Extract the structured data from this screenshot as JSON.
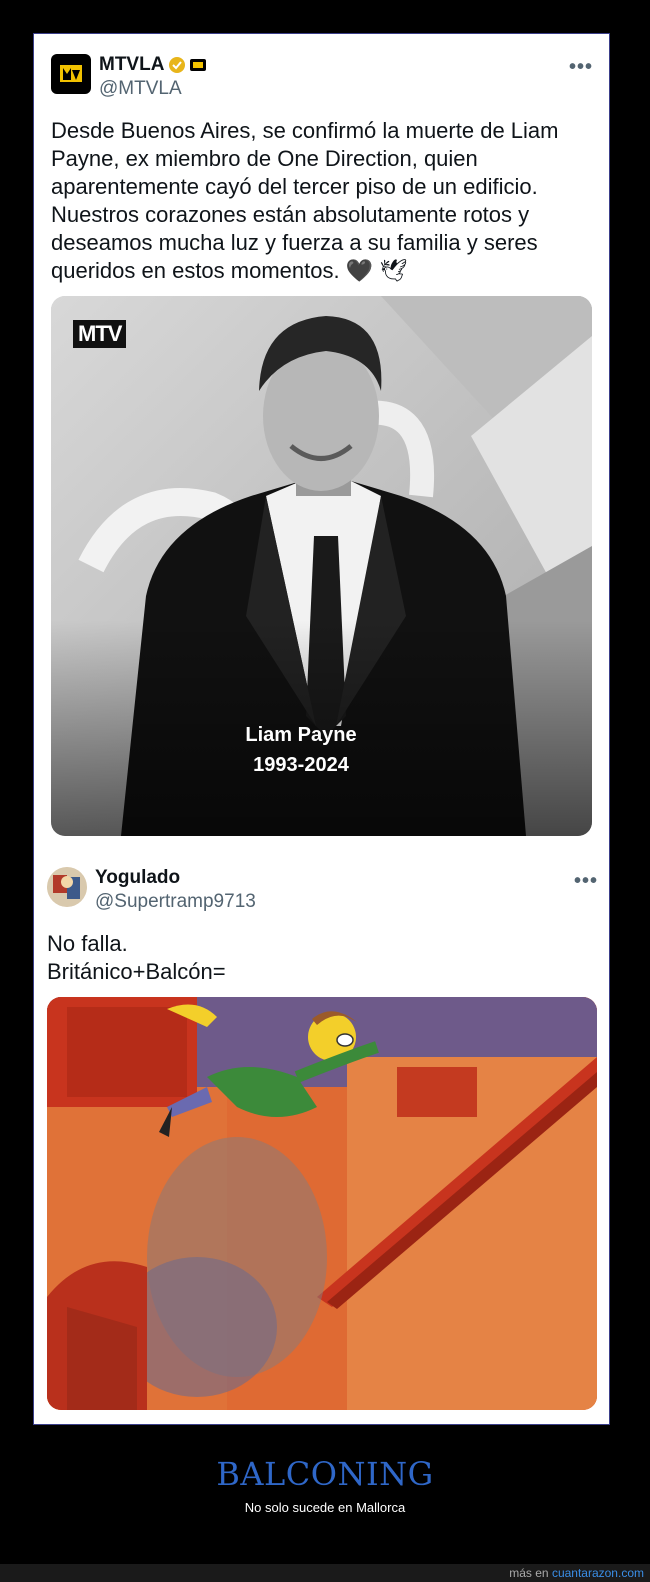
{
  "tweet1": {
    "display_name": "MTVLA",
    "handle": "@MTVLA",
    "more_label": "•••",
    "text": "Desde Buenos Aires, se confirmó la muerte de Liam\nPayne, ex miembro de One Direction, quien\naparentemente cayó del tercer piso de un edificio.\nNuestros corazones están absolutamente rotos y\ndeseamos mucha luz y fuerza a su familia y seres\nqueridos en estos momentos. 🖤 🕊",
    "media": {
      "logo": "MTV",
      "caption_name": "Liam Payne",
      "caption_years": "1993-2024"
    }
  },
  "tweet2": {
    "display_name": "Yogulado",
    "handle": "@Supertramp9713",
    "more_label": "•••",
    "text": "No falla.\nBritánico+Balcón="
  },
  "footer": {
    "title": "BALCONING",
    "subtitle": "No solo sucede en Mallorca",
    "credit_prefix": "más en",
    "credit_link": "cuantarazon.com"
  },
  "colors": {
    "verified": "#e8b51a",
    "title_blue": "#2f67c8",
    "link_blue": "#3a8ee6"
  }
}
